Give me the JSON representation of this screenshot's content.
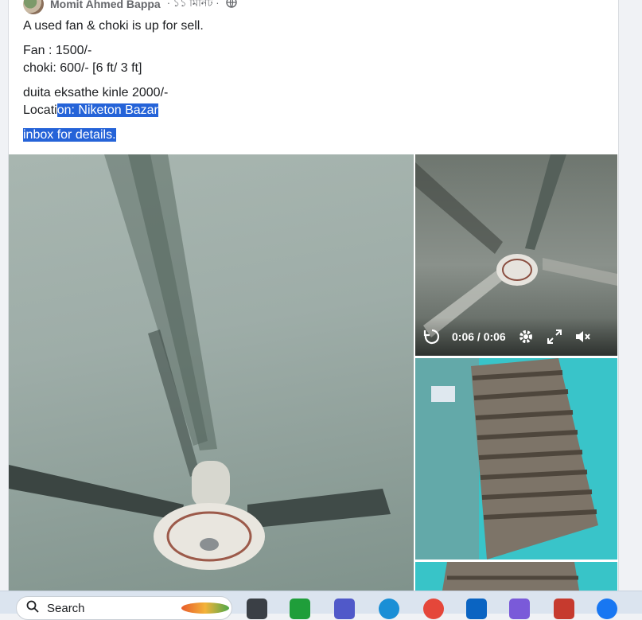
{
  "post": {
    "author": "Momit Ahmed Bappa",
    "time": "· ১১ মিনিট ·",
    "lines": {
      "l1": "A used fan & choki is up for sell.",
      "l2": "Fan : 1500/-",
      "l3": "choki: 600/- [6 ft/ 3 ft]",
      "l4": "duita eksathe kinle 2000/-",
      "l5a": "Locati",
      "l5b": "on: Niketon Bazar",
      "l6": "inbox for details."
    }
  },
  "video": {
    "time": "0:06 / 0:06"
  },
  "taskbar": {
    "search_label": "Search"
  }
}
